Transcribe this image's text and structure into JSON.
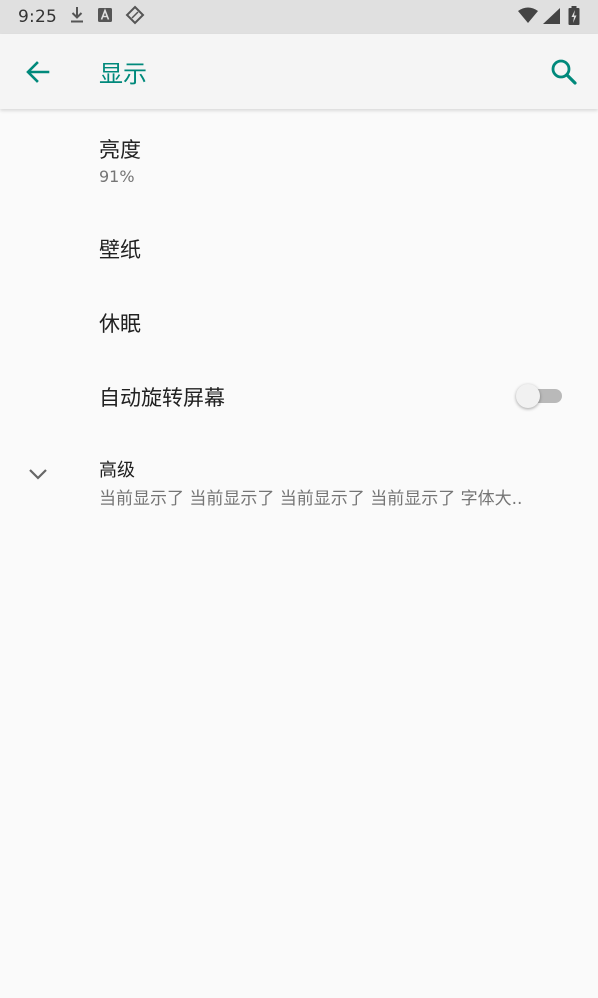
{
  "status_bar": {
    "time": "9:25",
    "icons": [
      "download-icon",
      "a-square-icon",
      "tag-icon"
    ],
    "right_icons": [
      "wifi-icon",
      "signal-icon",
      "battery-charging-icon"
    ]
  },
  "app_bar": {
    "title": "显示",
    "accent_color": "#00897b"
  },
  "items": [
    {
      "title": "亮度",
      "summary": "91%"
    },
    {
      "title": "壁纸"
    },
    {
      "title": "休眠"
    },
    {
      "title": "自动旋转屏幕",
      "toggle": false
    },
    {
      "title": "高级",
      "summary": "当前显示了 当前显示了 当前显示了 当前显示了 字体大.."
    }
  ]
}
